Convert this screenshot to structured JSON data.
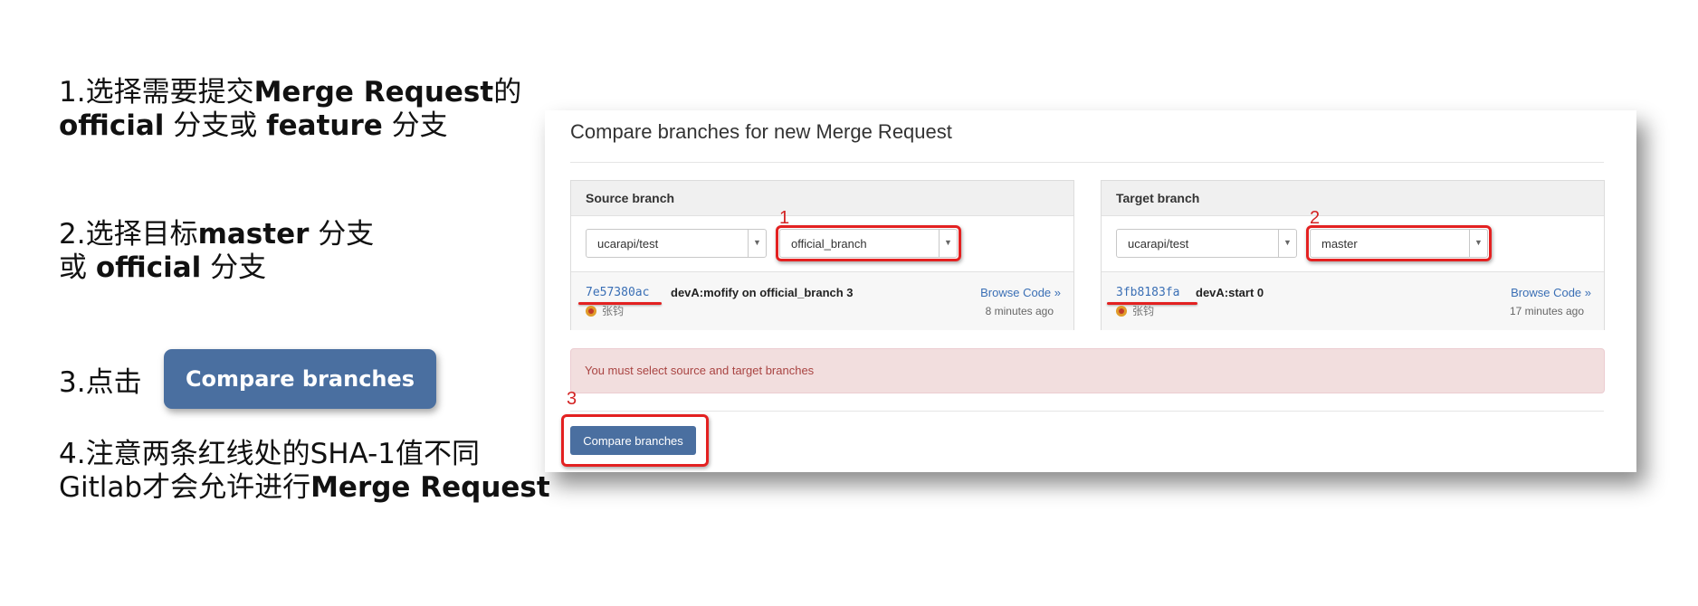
{
  "instructions": {
    "step1": {
      "line1_a": "1.选择需要提交",
      "line1_b": "Merge Request",
      "line1_c": "的",
      "line2_a": "official",
      "line2_b": " 分支或 ",
      "line2_c": "feature",
      "line2_d": " 分支"
    },
    "step2": {
      "line1_a": "2.选择目标",
      "line1_b": "master",
      "line1_c": " 分支",
      "line2_a": "或 ",
      "line2_b": "official",
      "line2_c": " 分支"
    },
    "step3": {
      "label": "3.点击",
      "button": "Compare branches"
    },
    "step4": {
      "line1": "4.注意两条红线处的SHA-1值不同",
      "line2_a": "Gitlab才会允许进行",
      "line2_b": "Merge Request"
    }
  },
  "panel": {
    "title": "Compare branches for new Merge Request",
    "source": {
      "heading": "Source branch",
      "project": "ucarapi/test",
      "branch": "official_branch",
      "marker": "1",
      "sha": "7e57380ac",
      "message": "devA:mofify on official_branch 3",
      "author": "张钧",
      "browse": "Browse Code »",
      "ago": "8 minutes ago"
    },
    "target": {
      "heading": "Target branch",
      "project": "ucarapi/test",
      "branch": "master",
      "marker": "2",
      "sha": "3fb8183fa",
      "message": "devA:start 0",
      "author": "张钧",
      "browse": "Browse Code »",
      "ago": "17 minutes ago"
    },
    "alert": "You must select source and target branches",
    "compare_marker": "3",
    "compare_button": "Compare branches"
  },
  "colors": {
    "accent_red": "#e32121",
    "button_blue": "#4a6fa0",
    "link_blue": "#3a6fb5",
    "alert_bg": "#f2dede"
  }
}
